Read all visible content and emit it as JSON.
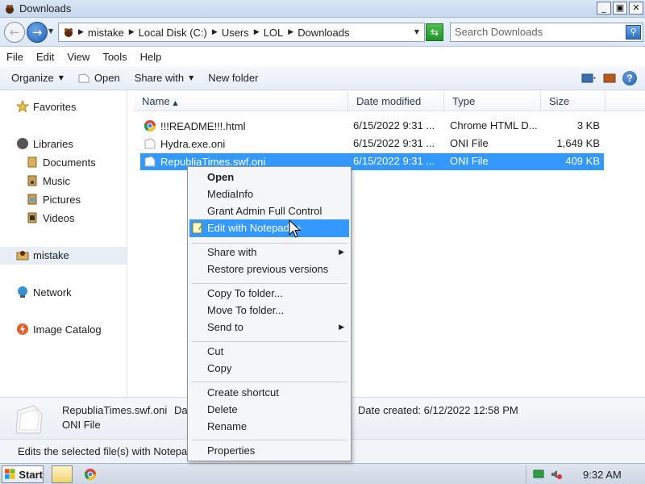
{
  "window": {
    "title": "Downloads"
  },
  "window_controls": {
    "minimize": "_",
    "maximize": "▣",
    "close": "✕"
  },
  "address": {
    "breadcrumbs": [
      "mistake",
      "Local Disk (C:)",
      "Users",
      "LOL",
      "Downloads"
    ],
    "search_placeholder": "Search Downloads"
  },
  "menubar": [
    "File",
    "Edit",
    "View",
    "Tools",
    "Help"
  ],
  "toolbar": {
    "organize": "Organize",
    "open": "Open",
    "share_with": "Share with",
    "new_folder": "New folder"
  },
  "navpane": {
    "favorites": "Favorites",
    "libraries": "Libraries",
    "documents": "Documents",
    "music": "Music",
    "pictures": "Pictures",
    "videos": "Videos",
    "homegroup": "mistake",
    "network": "Network",
    "image_catalog": "Image Catalog"
  },
  "columns": {
    "name": "Name",
    "date": "Date modified",
    "type": "Type",
    "size": "Size"
  },
  "files": [
    {
      "name": "!!!README!!!.html",
      "date": "6/15/2022 9:31 ...",
      "type": "Chrome HTML D...",
      "size": "3 KB"
    },
    {
      "name": "Hydra.exe.oni",
      "date": "6/15/2022 9:31 ...",
      "type": "ONI File",
      "size": "1,649 KB"
    },
    {
      "name": "RepubliaTimes.swf.oni",
      "date": "6/15/2022 9:31 ...",
      "type": "ONI File",
      "size": "409 KB"
    }
  ],
  "details": {
    "name": "RepubliaTimes.swf.oni",
    "type": "ONI File",
    "date_label_truncated": "Da",
    "created": "Date created: 6/12/2022 12:58 PM"
  },
  "status": {
    "text": "Edits the selected file(s) with Notepa"
  },
  "context_menu": {
    "open": "Open",
    "mediainfo": "MediaInfo",
    "grant_admin": "Grant Admin Full Control",
    "edit_notepad": "Edit with Notepad++",
    "share_with": "Share with",
    "restore": "Restore previous versions",
    "copy_to": "Copy To folder...",
    "move_to": "Move To folder...",
    "send_to": "Send to",
    "cut": "Cut",
    "copy": "Copy",
    "create_shortcut": "Create shortcut",
    "delete": "Delete",
    "rename": "Rename",
    "properties": "Properties"
  },
  "taskbar": {
    "start": "Start",
    "clock": "9:32 AM"
  },
  "colors": {
    "selection": "#3399ff",
    "accent": "#1d5fb4"
  }
}
